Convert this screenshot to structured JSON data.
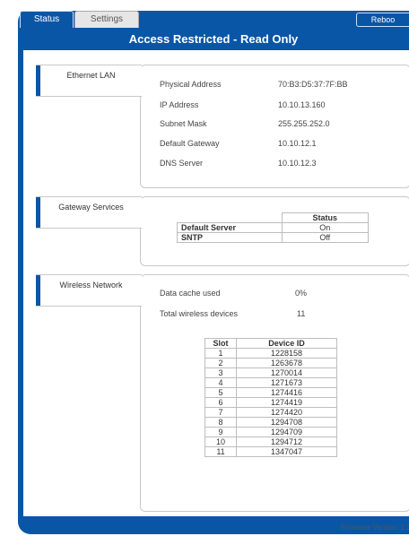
{
  "tabs": {
    "status": "Status",
    "settings": "Settings",
    "reboot": "Reboo"
  },
  "banner": "Access Restricted - Read Only",
  "footer": {
    "firmware": "Firmware Version: 1.2."
  },
  "ethernet": {
    "title": "Ethernet LAN",
    "rows": [
      {
        "label": "Physical Address",
        "value": "70:B3:D5:37:7F:BB"
      },
      {
        "label": "IP Address",
        "value": "10.10.13.160"
      },
      {
        "label": "Subnet Mask",
        "value": "255.255.252.0"
      },
      {
        "label": "Default Gateway",
        "value": "10.10.12.1"
      },
      {
        "label": "DNS Server",
        "value": "10.10.12.3"
      }
    ]
  },
  "gateway": {
    "title": "Gateway Services",
    "status_header": "Status",
    "rows": [
      {
        "name": "Default Server",
        "status": "On"
      },
      {
        "name": "SNTP",
        "status": "Off"
      }
    ]
  },
  "wireless": {
    "title": "Wireless Network",
    "cache_label": "Data cache used",
    "cache_value": "0%",
    "devices_label": "Total wireless devices",
    "devices_value": "11",
    "headers": {
      "slot": "Slot",
      "device": "Device ID"
    },
    "rows": [
      {
        "slot": "1",
        "id": "1228158"
      },
      {
        "slot": "2",
        "id": "1263678"
      },
      {
        "slot": "3",
        "id": "1270014"
      },
      {
        "slot": "4",
        "id": "1271673"
      },
      {
        "slot": "5",
        "id": "1274416"
      },
      {
        "slot": "6",
        "id": "1274419"
      },
      {
        "slot": "7",
        "id": "1274420"
      },
      {
        "slot": "8",
        "id": "1294708"
      },
      {
        "slot": "9",
        "id": "1294709"
      },
      {
        "slot": "10",
        "id": "1294712"
      },
      {
        "slot": "11",
        "id": "1347047"
      }
    ]
  }
}
